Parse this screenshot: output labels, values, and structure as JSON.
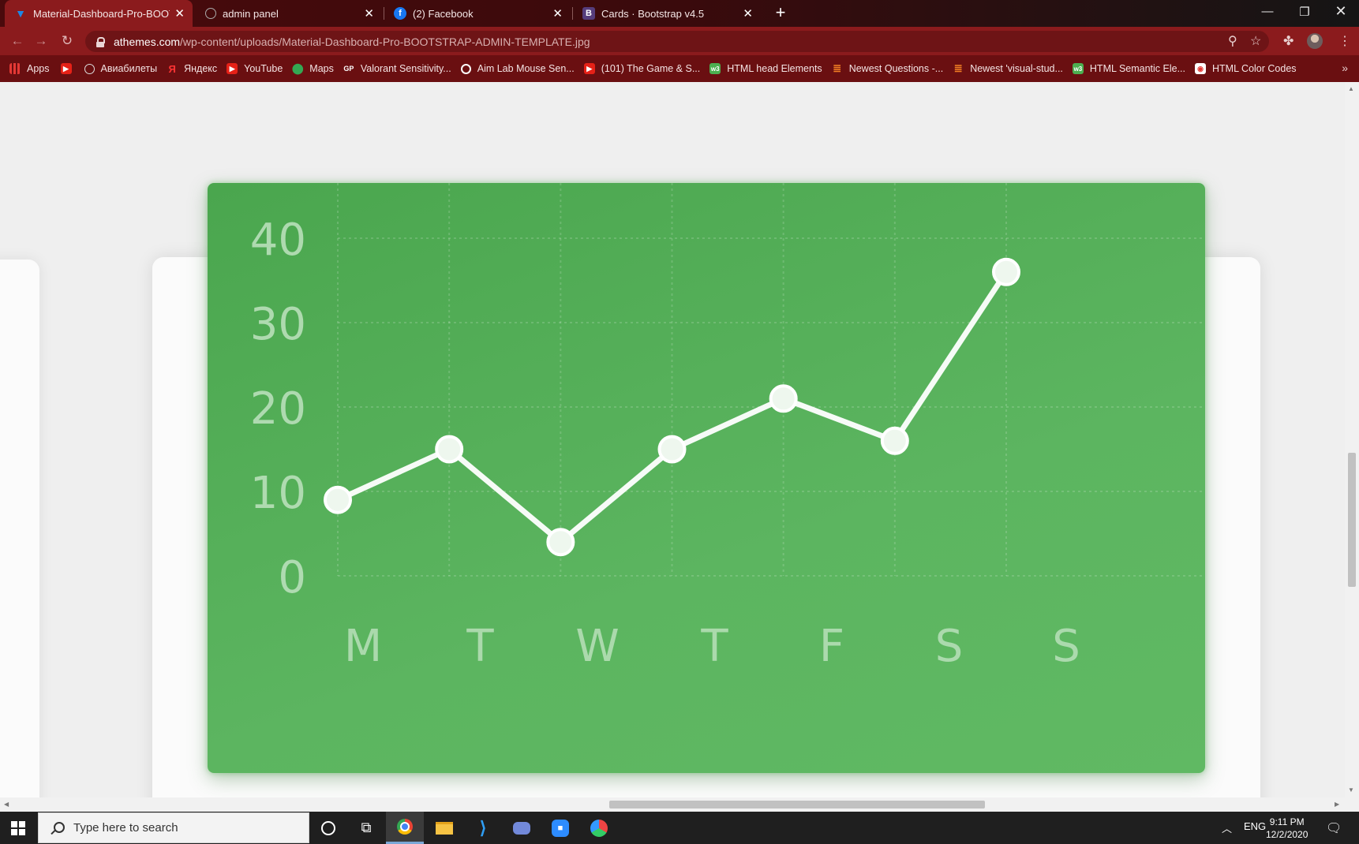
{
  "browser": {
    "tabs": [
      {
        "title": "Material-Dashboard-Pro-BOOTSTRAP",
        "favicon": "vuetify-icon",
        "active": true
      },
      {
        "title": "admin panel",
        "favicon": "globe-icon",
        "active": false
      },
      {
        "title": "(2) Facebook",
        "favicon": "facebook-icon",
        "active": false
      },
      {
        "title": "Cards · Bootstrap v4.5",
        "favicon": "bootstrap-icon",
        "active": false
      }
    ],
    "url_host": "athemes.com",
    "url_path": "/wp-content/uploads/Material-Dashboard-Pro-BOOTSTRAP-ADMIN-TEMPLATE.jpg",
    "bookmarks": [
      {
        "label": "Apps",
        "icon": "apps-grid-icon"
      },
      {
        "label": "",
        "icon": "youtube-icon"
      },
      {
        "label": "Авиабилеты",
        "icon": "globe-icon"
      },
      {
        "label": "Яндекс",
        "icon": "yandex-icon"
      },
      {
        "label": "YouTube",
        "icon": "youtube-icon"
      },
      {
        "label": "Maps",
        "icon": "maps-pin-icon"
      },
      {
        "label": "Valorant Sensitivity...",
        "icon": "gp-icon"
      },
      {
        "label": "Aim Lab Mouse Sen...",
        "icon": "target-icon"
      },
      {
        "label": "(101) The Game & S...",
        "icon": "youtube-icon"
      },
      {
        "label": "HTML head Elements",
        "icon": "w3-icon"
      },
      {
        "label": "Newest Questions -...",
        "icon": "stackoverflow-icon"
      },
      {
        "label": "Newest 'visual-stud...",
        "icon": "stackoverflow-icon"
      },
      {
        "label": "HTML Semantic Ele...",
        "icon": "w3-icon"
      },
      {
        "label": "HTML Color Codes",
        "icon": "color-codes-icon"
      }
    ]
  },
  "chart_data": {
    "type": "line",
    "categories": [
      "M",
      "T",
      "W",
      "T",
      "F",
      "S",
      "S"
    ],
    "values": [
      9,
      15,
      4,
      15,
      21,
      16,
      36
    ],
    "ylim": [
      0,
      40
    ],
    "yticks": [
      "0",
      "10",
      "20",
      "30",
      "40"
    ],
    "grid": true,
    "colors": {
      "card": "#55b159",
      "line": "#ffffff",
      "labels": "#bfe3c0"
    }
  },
  "taskbar": {
    "search_placeholder": "Type here to search",
    "language": "ENG",
    "time": "9:11 PM",
    "date": "12/2/2020"
  }
}
